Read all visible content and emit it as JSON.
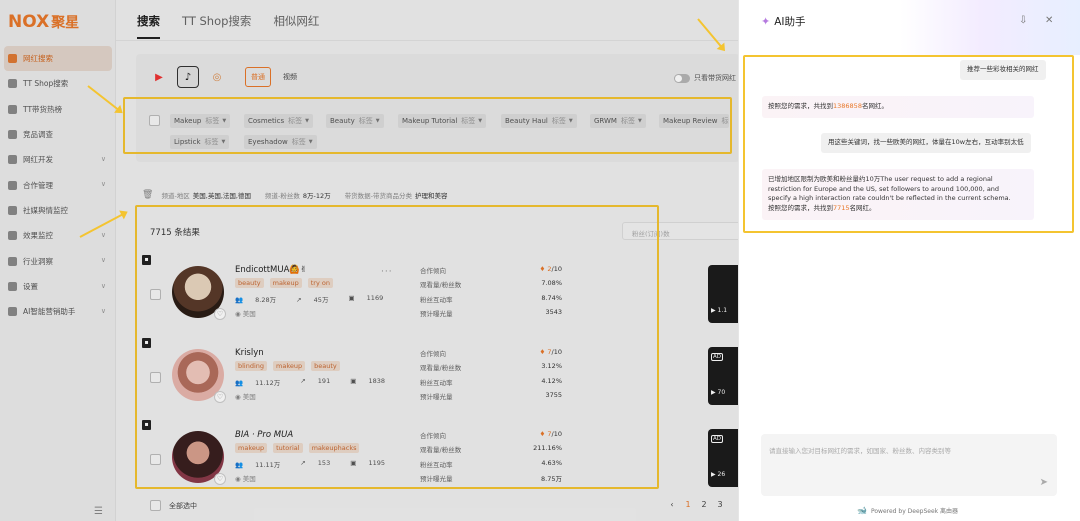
{
  "brand": {
    "logo_text": "NOX",
    "logo_cn": "聚星"
  },
  "sidebar": {
    "items": [
      {
        "label": "网红搜索",
        "chevron": ""
      },
      {
        "label": "TT Shop搜索",
        "chevron": ""
      },
      {
        "label": "TT带货热榜",
        "chevron": ""
      },
      {
        "label": "竞品调查",
        "chevron": ""
      },
      {
        "label": "网红开发",
        "chevron": "∨"
      },
      {
        "label": "合作管理",
        "chevron": "∨"
      },
      {
        "label": "社媒舆情监控",
        "chevron": ""
      },
      {
        "label": "效果监控",
        "chevron": "∨"
      },
      {
        "label": "行业洞察",
        "chevron": "∨"
      },
      {
        "label": "设置",
        "chevron": "∨"
      },
      {
        "label": "AI智能营销助手",
        "chevron": "∨"
      }
    ]
  },
  "tabs": [
    {
      "label": "搜索"
    },
    {
      "label": "TT Shop搜索"
    },
    {
      "label": "相似网红"
    }
  ],
  "search": {
    "mode_active": "普通",
    "mode_other": "视频",
    "toggle_label": "只看带货网红"
  },
  "tags": [
    {
      "name": "Makeup",
      "sub": "标签"
    },
    {
      "name": "Cosmetics",
      "sub": "标签"
    },
    {
      "name": "Beauty",
      "sub": "标签"
    },
    {
      "name": "Makeup Tutorial",
      "sub": "标签"
    },
    {
      "name": "Beauty Haul",
      "sub": "标签"
    },
    {
      "name": "GRWM",
      "sub": "标签"
    },
    {
      "name": "Makeup Review",
      "sub": "标签"
    },
    {
      "name": "Lipstick",
      "sub": "标签"
    },
    {
      "name": "Eyeshadow",
      "sub": "标签"
    }
  ],
  "filters": [
    {
      "key": "频道-地区",
      "value": "美国,英国,法国,德国"
    },
    {
      "key": "频道-粉丝数",
      "value": "8万-12万"
    },
    {
      "key": "带货数据-带货商品分类",
      "value": "护理和美容"
    }
  ],
  "results": {
    "count_text": "7715 条结果",
    "sort_placeholder": "粉丝(订阅)数",
    "metric_labels": [
      "合作倾向",
      "观看量/粉丝数",
      "粉丝互动率",
      "预计曝光量"
    ],
    "rows": [
      {
        "name": "EndicottMUA🙆✌",
        "chips": [
          "beauty",
          "makeup",
          "try on"
        ],
        "followers": "8.28万",
        "avg": "45万",
        "videos": "1169",
        "country": "美国",
        "coop_value": "2",
        "coop_max": "/10",
        "views_ratio": "7.08%",
        "engagement": "8.74%",
        "exposure": "3543",
        "thumb_label": "1.1",
        "thumb_ad": ""
      },
      {
        "name": "Krislyn",
        "chips": [
          "blinding",
          "makeup",
          "beauty"
        ],
        "followers": "11.12万",
        "avg": "191",
        "videos": "1838",
        "country": "美国",
        "coop_value": "7",
        "coop_max": "/10",
        "views_ratio": "3.12%",
        "engagement": "4.12%",
        "exposure": "3755",
        "thumb_label": "70",
        "thumb_ad": "AD"
      },
      {
        "name": "BIA · Pro MUA",
        "chips": [
          "makeup",
          "tutorial",
          "makeuphacks"
        ],
        "followers": "11.11万",
        "avg": "153",
        "videos": "1195",
        "country": "美国",
        "coop_value": "7",
        "coop_max": "/10",
        "views_ratio": "211.16%",
        "engagement": "4.63%",
        "exposure": "8.75万",
        "thumb_label": "26",
        "thumb_ad": "AD"
      }
    ]
  },
  "footer": {
    "select_all": "全部选中",
    "pages": [
      "1",
      "2",
      "3"
    ]
  },
  "ai": {
    "title": "AI助手",
    "messages": [
      {
        "role": "user",
        "text": "推荐一些彩妆相关的网红"
      },
      {
        "role": "bot",
        "pre": "按照您的需求，共找到",
        "hl": "1386858",
        "post": "名网红。"
      },
      {
        "role": "user",
        "text": "用这些关键词，找一些欧美的网红，体量在10w左右，互动率别太低"
      },
      {
        "role": "bot",
        "line1": "已增加地区限制为欧美和粉丝量约10万The user request to add a regional",
        "line2": "restriction for Europe and the US, set followers to around 100,000, and",
        "line3": "specify a high interaction rate couldn't be reflected in the current schema.",
        "pre": "按照您的需求，共找到",
        "hl": "7715",
        "post": "名网红。"
      }
    ],
    "input_placeholder": "请直接输入您对目标网红的需求，如国家、粉丝数、内容类别等",
    "powered_by": "Powered by DeepSeek 离由器"
  },
  "colors": {
    "accent": "#e8782a",
    "highlight_box": "#f4c430"
  }
}
